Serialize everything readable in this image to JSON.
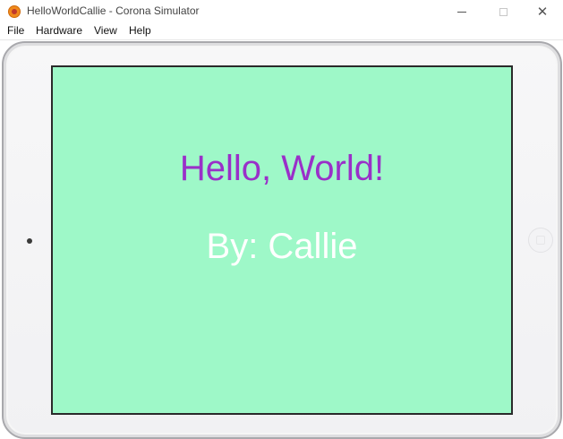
{
  "window": {
    "title": "HelloWorldCallie - Corona Simulator",
    "app_icon": "corona-app-icon",
    "controls": {
      "minimize_icon": "minimize-icon",
      "maximize_icon": "maximize-icon",
      "close_icon": "close-icon",
      "close_glyph": "✕"
    }
  },
  "menu": {
    "items": [
      {
        "label": "File"
      },
      {
        "label": "Hardware"
      },
      {
        "label": "View"
      },
      {
        "label": "Help"
      }
    ]
  },
  "device": {
    "type": "tablet-landscape",
    "frame_color": "#f4f4f6",
    "camera_icon": "camera-icon",
    "home_button_icon": "home-button-icon"
  },
  "app_screen": {
    "background_color": "#9ef8c8",
    "headline": "Hello, World!",
    "headline_color": "#9a2fc9",
    "byline": "By: Callie",
    "byline_color": "#ffffff"
  }
}
